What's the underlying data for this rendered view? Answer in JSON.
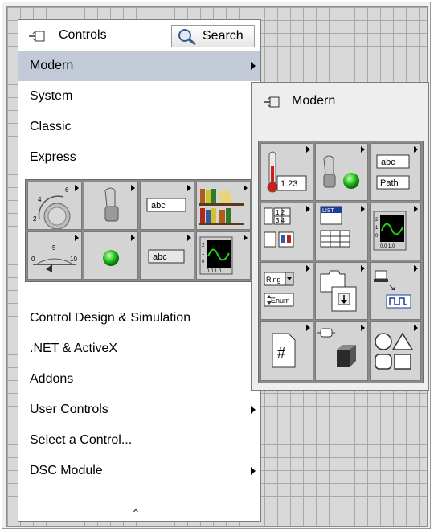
{
  "palette": {
    "title": "Controls",
    "search_label": "Search",
    "menu": [
      {
        "label": "Modern",
        "arrow": true,
        "selected": true
      },
      {
        "label": "System",
        "arrow": true,
        "selected": false
      },
      {
        "label": "Classic",
        "arrow": true,
        "selected": false
      },
      {
        "label": "Express",
        "arrow": true,
        "selected": false
      }
    ],
    "menu_lower": [
      {
        "label": "Control Design & Simulation",
        "arrow": true
      },
      {
        "label": ".NET & ActiveX",
        "arrow": true
      },
      {
        "label": "Addons",
        "arrow": true
      },
      {
        "label": "User Controls",
        "arrow": true
      },
      {
        "label": "Select a Control...",
        "arrow": false
      },
      {
        "label": "DSC Module",
        "arrow": true
      }
    ],
    "express_tiles": [
      {
        "icon": "knob-icon",
        "text": "6 4 2"
      },
      {
        "icon": "toggle-switch-icon",
        "text": ""
      },
      {
        "icon": "string-control-icon",
        "text": "abc"
      },
      {
        "icon": "books-icon",
        "text": ""
      },
      {
        "icon": "slider-icon",
        "text": "0 5 10"
      },
      {
        "icon": "led-icon",
        "text": ""
      },
      {
        "icon": "string-indicator-icon",
        "text": "abc"
      },
      {
        "icon": "graph-icon",
        "text": "0.0 1.0"
      }
    ],
    "collapse_glyph": "⌃"
  },
  "modern": {
    "title": "Modern",
    "tiles": [
      {
        "icon": "numeric-icon",
        "text": "1.23"
      },
      {
        "icon": "boolean-icon",
        "text": ""
      },
      {
        "icon": "string-path-icon",
        "text": "abc",
        "text2": "Path"
      },
      {
        "icon": "array-matrix-cluster-icon",
        "text": "1 2 3 4"
      },
      {
        "icon": "list-table-tree-icon",
        "text": "LIST"
      },
      {
        "icon": "graph-icon",
        "text": "0.0 1.0"
      },
      {
        "icon": "ring-enum-icon",
        "text": "Ring",
        "text2": "Enum"
      },
      {
        "icon": "containers-icon",
        "text": ""
      },
      {
        "icon": "io-icon",
        "text": ""
      },
      {
        "icon": "variant-class-icon",
        "text": "#"
      },
      {
        "icon": "decorations-icon",
        "text": ""
      },
      {
        "icon": "shapes-icon",
        "text": ""
      }
    ]
  },
  "colors": {
    "selected_bg": "#c2cad8",
    "grid_bg": "#d9d9d9",
    "led_green": "#22c01a"
  }
}
